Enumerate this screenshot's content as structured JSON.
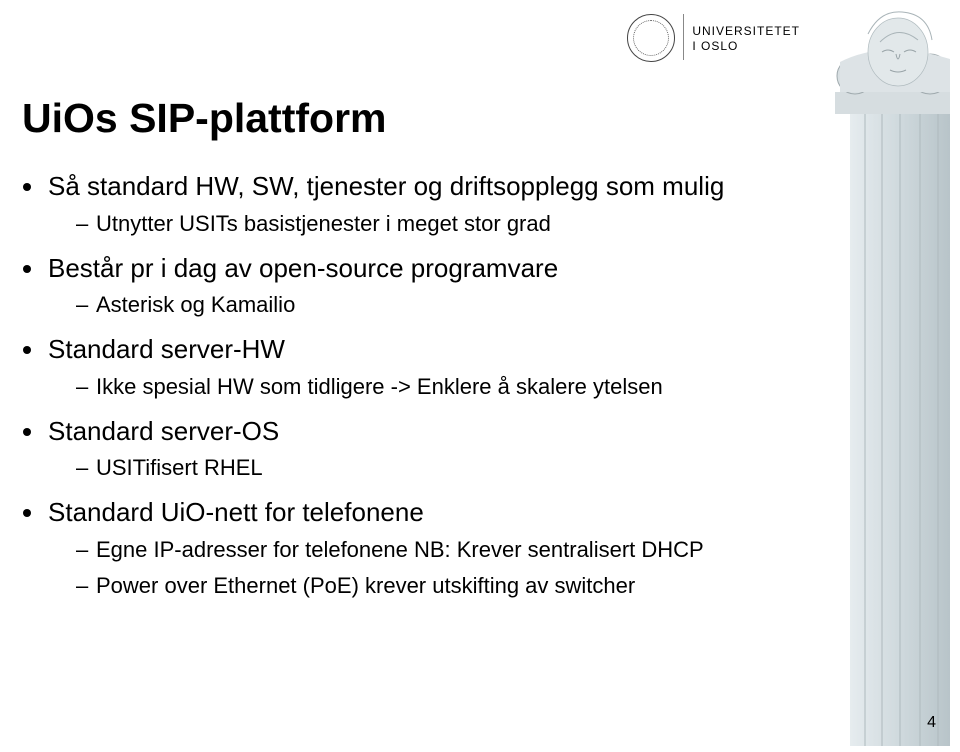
{
  "header": {
    "uni_line1": "UNIVERSITETET",
    "uni_line2": "I OSLO"
  },
  "title": "UiOs SIP-plattform",
  "bullets": [
    {
      "text": "Så standard HW, SW, tjenester og driftsopplegg som mulig",
      "sub": [
        {
          "text": "Utnytter USITs basistjenester i meget stor grad"
        }
      ]
    },
    {
      "text": "Består pr i dag av open-source programvare",
      "sub": [
        {
          "text": "Asterisk og Kamailio"
        }
      ]
    },
    {
      "text": "Standard server-HW",
      "sub": [
        {
          "text": "Ikke spesial HW som tidligere -> Enklere å skalere ytelsen"
        }
      ]
    },
    {
      "text": "Standard server-OS",
      "sub": [
        {
          "text": "USITifisert RHEL"
        }
      ]
    },
    {
      "text": "Standard UiO-nett for telefonene",
      "sub": [
        {
          "text": "Egne IP-adresser for telefonene NB: Krever sentralisert DHCP"
        },
        {
          "text": "Power over Ethernet (PoE) krever utskifting av switcher"
        }
      ]
    }
  ],
  "page_number": "4"
}
